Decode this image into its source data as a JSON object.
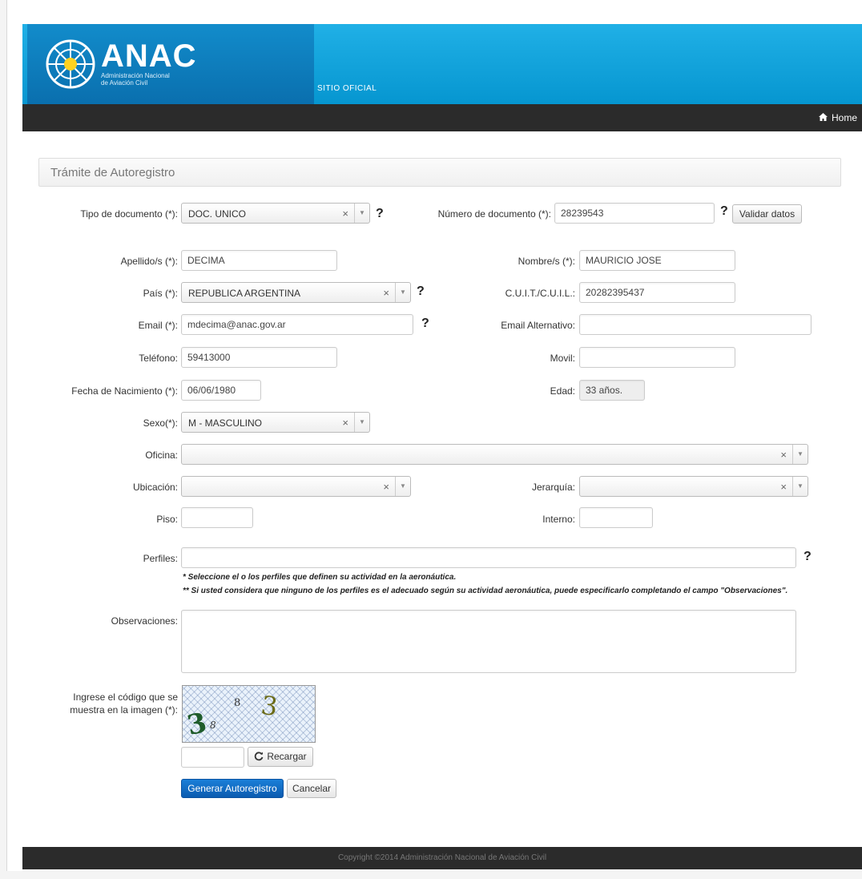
{
  "header": {
    "brand": "ANAC",
    "brand_sub_1": "Administración Nacional",
    "brand_sub_2": "de Aviación Civil",
    "site_label": "SITIO OFICIAL",
    "accent_color": "#0aa0d8"
  },
  "navbar": {
    "home_label": "Home",
    "home_icon": "home-icon"
  },
  "panel": {
    "title": "Trámite de Autoregistro"
  },
  "form": {
    "tipo_documento": {
      "label": "Tipo de documento (*):",
      "value": "DOC. UNICO"
    },
    "numero_documento": {
      "label": "Número de documento (*):",
      "value": "28239543",
      "validate_label": "Validar datos"
    },
    "apellidos": {
      "label": "Apellido/s (*):",
      "value": "DECIMA"
    },
    "nombres": {
      "label": "Nombre/s (*):",
      "value": "MAURICIO JOSE"
    },
    "pais": {
      "label": "País (*):",
      "value": "REPUBLICA ARGENTINA"
    },
    "cuit": {
      "label": "C.U.I.T./C.U.I.L.:",
      "value": "20282395437"
    },
    "email": {
      "label": "Email (*):",
      "value": "mdecima@anac.gov.ar"
    },
    "email_alt": {
      "label": "Email Alternativo:",
      "value": ""
    },
    "telefono": {
      "label": "Teléfono:",
      "value": "59413000"
    },
    "movil": {
      "label": "Movil:",
      "value": ""
    },
    "fecha_nacimiento": {
      "label": "Fecha de Nacimiento (*):",
      "value": "06/06/1980"
    },
    "edad": {
      "label": "Edad:",
      "value": "33 años."
    },
    "sexo": {
      "label": "Sexo(*):",
      "value": "M - MASCULINO"
    },
    "oficina": {
      "label": "Oficina:",
      "value": ""
    },
    "ubicacion": {
      "label": "Ubicación:",
      "value": ""
    },
    "jerarquia": {
      "label": "Jerarquía:",
      "value": ""
    },
    "piso": {
      "label": "Piso:",
      "value": ""
    },
    "interno": {
      "label": "Interno:",
      "value": ""
    },
    "perfiles": {
      "label": "Perfiles:",
      "value": ""
    },
    "note_1": "* Seleccione el o los perfiles que definen su actividad en la aeronáutica.",
    "note_2": "** Si usted considera que ninguno de los perfiles es el adecuado según su actividad aeronáutica, puede especificarlo completando el campo \"Observaciones\".",
    "observaciones": {
      "label": "Observaciones:",
      "value": ""
    },
    "captcha": {
      "label_1": "Ingrese el código que se",
      "label_2": "muestra en la imagen (*):",
      "input_value": "",
      "reload_label": "Recargar",
      "characters": [
        "3",
        "8",
        "8",
        "3"
      ]
    },
    "submit_label": "Generar Autoregistro",
    "cancel_label": "Cancelar",
    "help_symbol": "?",
    "clear_symbol": "×",
    "arrow_symbol": "▼"
  },
  "footer": {
    "copyright": "Copyright ©2014 Administración Nacional de Aviación Civil"
  }
}
